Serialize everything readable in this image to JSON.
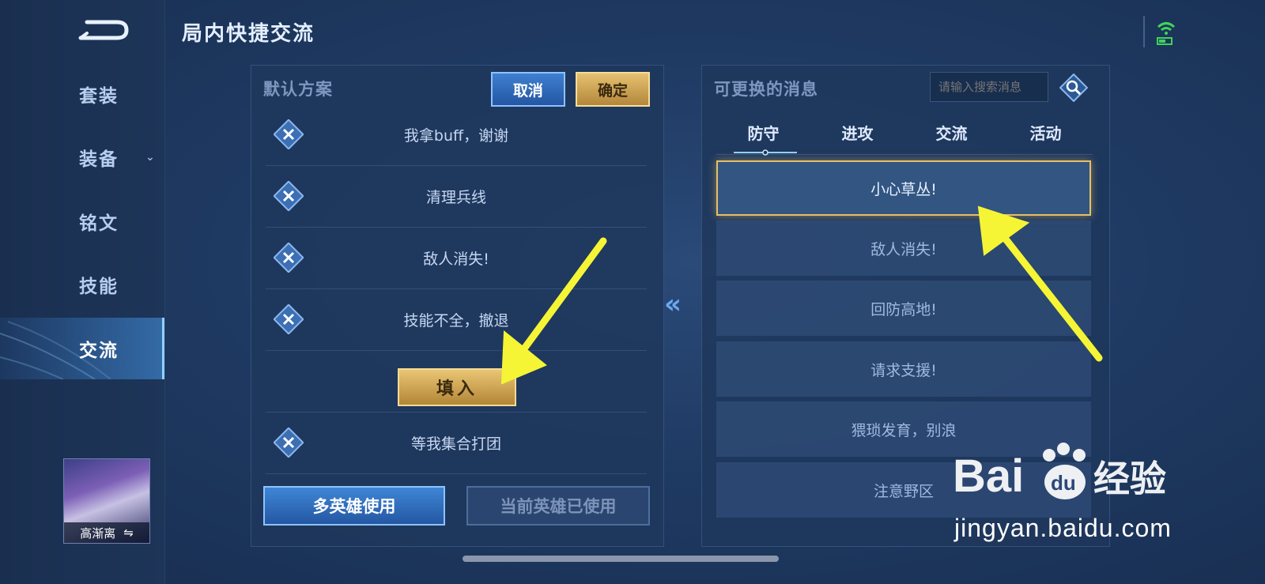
{
  "header": {
    "title": "局内快捷交流"
  },
  "sidebar": {
    "items": [
      {
        "label": "套装",
        "active": false
      },
      {
        "label": "装备",
        "active": false
      },
      {
        "label": "铭文",
        "active": false
      },
      {
        "label": "技能",
        "active": false
      },
      {
        "label": "交流",
        "active": true
      }
    ],
    "hero_name": "高渐离",
    "hero_swap_symbol": "⇋"
  },
  "left_panel": {
    "heading": "默认方案",
    "cancel_label": "取消",
    "confirm_label": "确定",
    "rows": [
      "我拿buff，谢谢",
      "清理兵线",
      "敌人消失!",
      "技能不全，撤退",
      "",
      "等我集合打团"
    ],
    "fill_label": "填入",
    "multi_hero_label": "多英雄使用",
    "current_hero_used_label": "当前英雄已使用"
  },
  "move_arrows": "«",
  "right_panel": {
    "heading": "可更换的消息",
    "search_placeholder": "请输入搜索消息",
    "tabs": [
      "防守",
      "进攻",
      "交流",
      "活动"
    ],
    "active_tab": 0,
    "messages": [
      {
        "text": "小心草丛!",
        "selected": true
      },
      {
        "text": "敌人消失!",
        "selected": false
      },
      {
        "text": "回防高地!",
        "selected": false
      },
      {
        "text": "请求支援!",
        "selected": false
      },
      {
        "text": "猥琐发育，别浪",
        "selected": false
      },
      {
        "text": "注意野区",
        "selected": false
      }
    ]
  },
  "watermark": {
    "text": "jingyan.baidu.com"
  },
  "colors": {
    "accent_gold": "#e7bf62",
    "accent_blue": "#3f80d0",
    "annotation_yellow": "#f5f535"
  },
  "icons": [
    "back-icon",
    "wifi-icon",
    "battery-icon",
    "remove-x-icon",
    "search-icon",
    "chevron-down-icon",
    "double-left-arrow-icon"
  ]
}
